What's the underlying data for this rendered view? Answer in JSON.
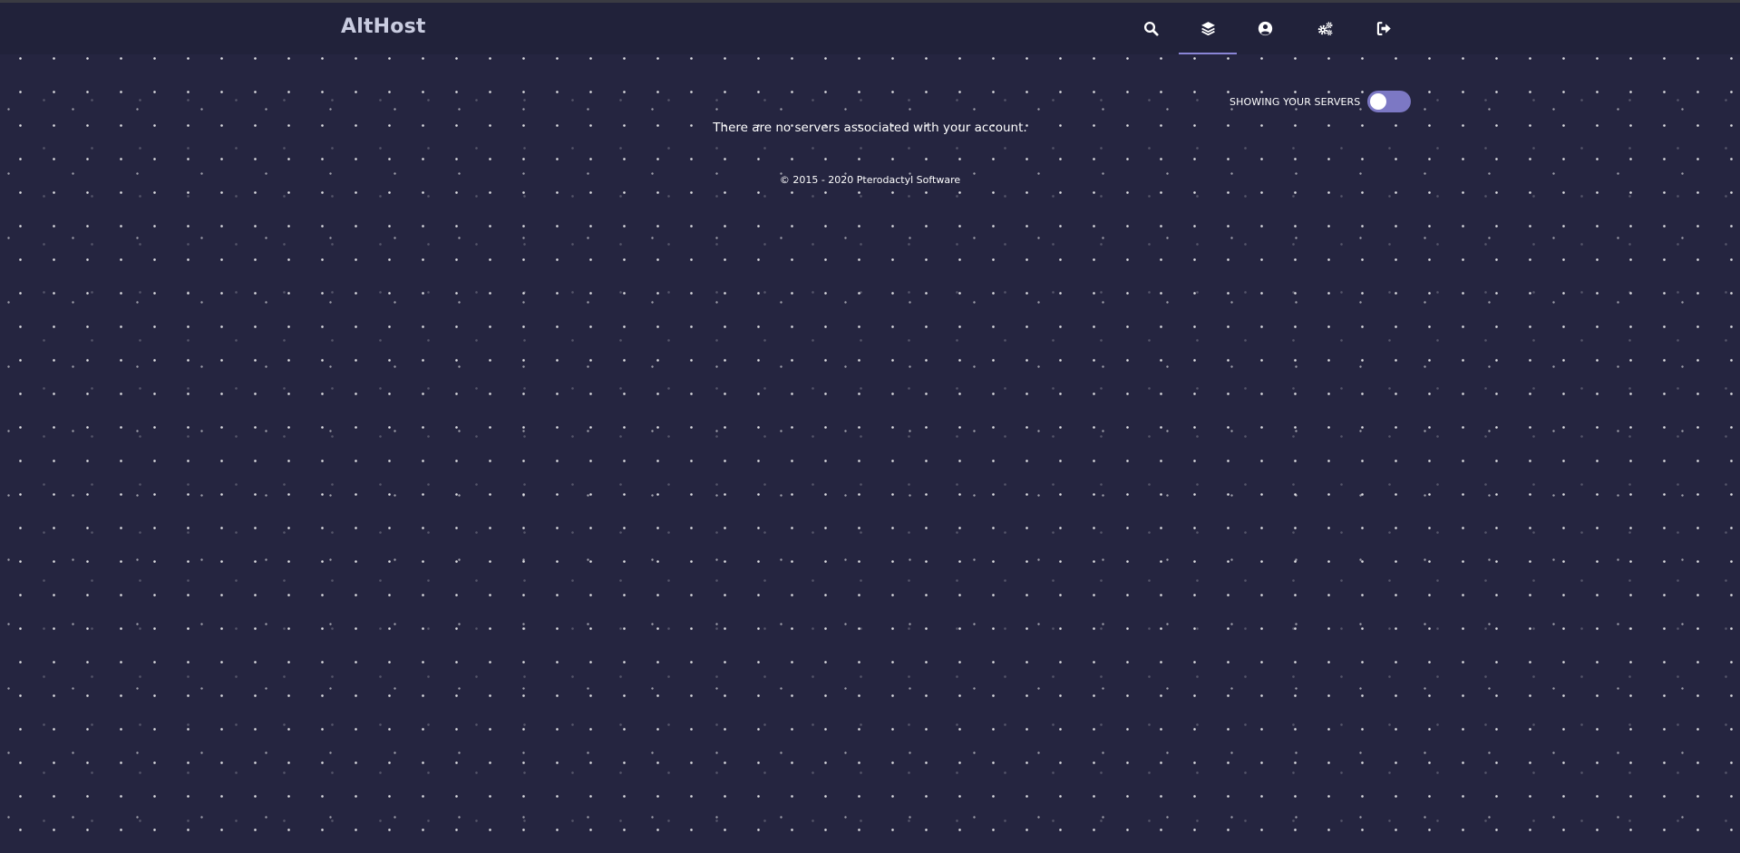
{
  "navbar": {
    "brand": "AltHost",
    "items": [
      {
        "icon": "search-icon",
        "active": false
      },
      {
        "icon": "layers-icon",
        "active": true
      },
      {
        "icon": "user-circle-icon",
        "active": false
      },
      {
        "icon": "cogs-icon",
        "active": false
      },
      {
        "icon": "sign-out-icon",
        "active": false
      }
    ],
    "active_underline_color": "#8a85d6"
  },
  "server_filter": {
    "label": "SHOWING YOUR SERVERS",
    "toggle_on": true,
    "toggle_color": "#7c78c4"
  },
  "main": {
    "empty_message": "There are no servers associated with your account."
  },
  "footer": {
    "copyright": "© 2015 - 2020 Pterodactyl Software"
  },
  "colors": {
    "background": "#252540",
    "navbar": "#21223a"
  }
}
